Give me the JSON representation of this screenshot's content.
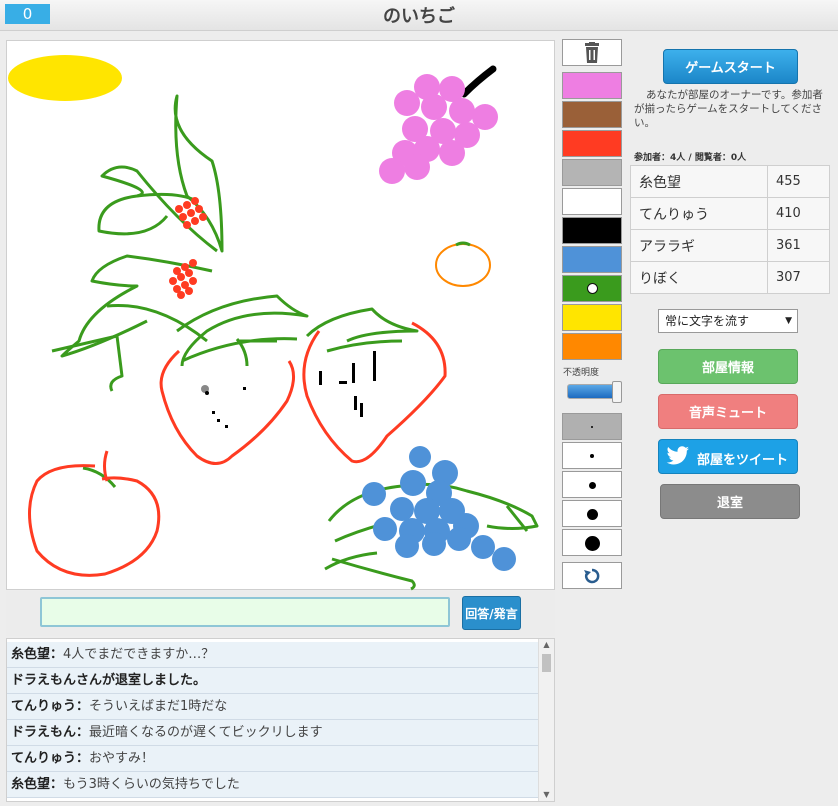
{
  "header": {
    "timer": "0",
    "title": "のいちご"
  },
  "input": {
    "placeholder": "",
    "submit_label": "回答/発言"
  },
  "chat": [
    {
      "name": "糸色望",
      "sep": "：",
      "text": "4人でまだできますか…？"
    },
    {
      "system": "ドラえもんさんが退室しました。"
    },
    {
      "name": "てんりゅう",
      "sep": "：",
      "text": "そういえばまだ1時だな"
    },
    {
      "name": "ドラえもん",
      "sep": "：",
      "text": "最近暗くなるのが遅くてビックリします"
    },
    {
      "name": "てんりゅう",
      "sep": "：",
      "text": "おやすみ！"
    },
    {
      "name": "糸色望",
      "sep": "：",
      "text": "もう3時くらいの気持ちでした"
    }
  ],
  "tools": {
    "palette": [
      "#ee7ee2",
      "#9a6038",
      "#ff3b22",
      "#b4b4b4",
      "#ffffff",
      "#000000",
      "#4f92d8",
      "#3a9b1d",
      "#ffe500",
      "#ff8800"
    ],
    "selected_color_index": 7,
    "opacity_label": "不透明度",
    "opacity_value": 1.0,
    "brush_sizes_selected_index": 0,
    "trash_icon": "trash-icon",
    "undo_icon": "undo-icon"
  },
  "panel": {
    "start_label": "ゲームスタート",
    "owner_note": "あなたが部屋のオーナーです。参加者が揃ったらゲームをスタートしてください。",
    "participants": "参加者：4人 / 閲覧者：0人",
    "scores": [
      {
        "name": "糸色望",
        "points": "455"
      },
      {
        "name": "てんりゅう",
        "points": "410"
      },
      {
        "name": "アララギ",
        "points": "361"
      },
      {
        "name": "りぼく",
        "points": "307"
      }
    ],
    "scroll_select": "常に文字を流す",
    "room_info_label": "部屋情報",
    "mute_label": "音声ミュート",
    "tweet_label": "部屋をツイート",
    "leave_label": "退室"
  }
}
